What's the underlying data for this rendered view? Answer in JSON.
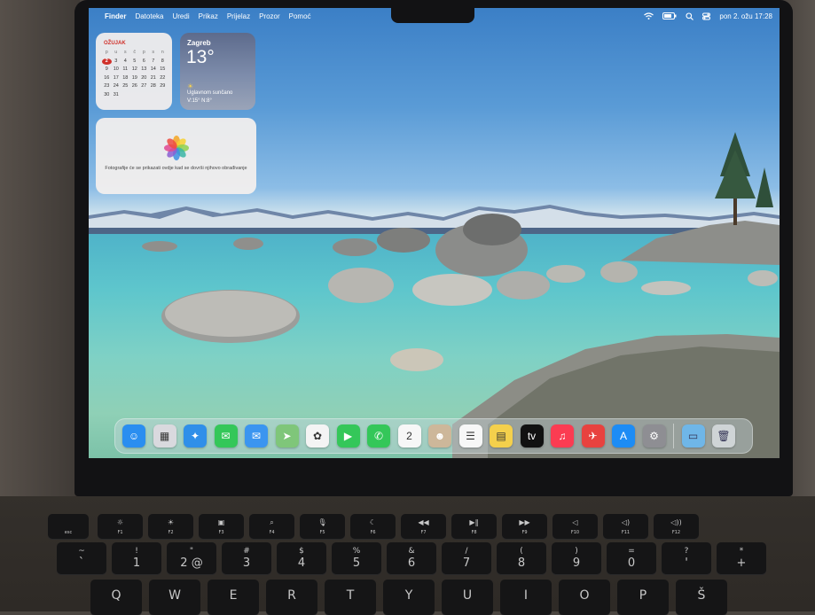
{
  "menubar": {
    "apple_glyph": "",
    "items": [
      "Finder",
      "Datoteka",
      "Uredi",
      "Prikaz",
      "Prijelaz",
      "Prozor",
      "Pomoć"
    ],
    "status_icons": [
      "wifi-icon",
      "battery-icon",
      "search-icon",
      "control-center-icon"
    ],
    "clock": "pon 2. ožu  17:28"
  },
  "calendar_widget": {
    "month": "OŽUJAK",
    "weekdays": [
      "p",
      "u",
      "s",
      "č",
      "p",
      "s",
      "n"
    ],
    "days": [
      [
        "",
        "",
        "",
        "",
        "",
        "",
        ""
      ],
      [
        "2",
        "3",
        "4",
        "5",
        "6",
        "7",
        "8"
      ],
      [
        "9",
        "10",
        "11",
        "12",
        "13",
        "14",
        "15"
      ],
      [
        "16",
        "17",
        "18",
        "19",
        "20",
        "21",
        "22"
      ],
      [
        "23",
        "24",
        "25",
        "26",
        "27",
        "28",
        "29"
      ],
      [
        "30",
        "31",
        "",
        "",
        "",
        "",
        ""
      ]
    ],
    "today": "2",
    "today_color": "#d0302a"
  },
  "weather_widget": {
    "city": "Zagreb",
    "temperature": "13°",
    "sun_glyph": "☀",
    "condition": "Uglavnom sunčano",
    "hi_lo": "V:15° N:8°"
  },
  "photos_widget": {
    "message": "Fotografije će se prikazati ovdje kad se dovrši njihovo obrađivanje"
  },
  "dock": {
    "apps": [
      {
        "name": "finder",
        "glyph": "☺",
        "color": "#2a8ef0"
      },
      {
        "name": "launchpad",
        "glyph": "▦",
        "color": "#d9d9de"
      },
      {
        "name": "safari",
        "glyph": "✦",
        "color": "#2f8fe9"
      },
      {
        "name": "messages",
        "glyph": "✉",
        "color": "#34c759"
      },
      {
        "name": "mail",
        "glyph": "✉",
        "color": "#3b95f0"
      },
      {
        "name": "maps",
        "glyph": "➤",
        "color": "#7fc67a"
      },
      {
        "name": "photos",
        "glyph": "✿",
        "color": "#f4f4f4"
      },
      {
        "name": "facetime",
        "glyph": "▶",
        "color": "#34c759"
      },
      {
        "name": "phone",
        "glyph": "✆",
        "color": "#34c759"
      },
      {
        "name": "calendar",
        "glyph": "2",
        "color": "#f7f7f7"
      },
      {
        "name": "contacts",
        "glyph": "☻",
        "color": "#cdb79a"
      },
      {
        "name": "reminders",
        "glyph": "☰",
        "color": "#f7f7f7"
      },
      {
        "name": "notes",
        "glyph": "▤",
        "color": "#f4d04c"
      },
      {
        "name": "tv",
        "glyph": "tv",
        "color": "#111111"
      },
      {
        "name": "music",
        "glyph": "♫",
        "color": "#fb3c52"
      },
      {
        "name": "rocket",
        "glyph": "✈",
        "color": "#e8423f"
      },
      {
        "name": "app-store",
        "glyph": "A",
        "color": "#1d8cf5"
      },
      {
        "name": "system-settings",
        "glyph": "⚙",
        "color": "#8e8e93"
      }
    ],
    "folder": {
      "name": "downloads-folder",
      "glyph": "▭",
      "color": "#6fb6e8"
    },
    "trash": {
      "name": "trash",
      "glyph": "🗑",
      "color": "#cfd4d6"
    }
  },
  "keyboard": {
    "fn_row": [
      {
        "label": "esc",
        "icon": ""
      },
      {
        "label": "F1",
        "icon": "☼"
      },
      {
        "label": "F2",
        "icon": "☀"
      },
      {
        "label": "F3",
        "icon": "▣"
      },
      {
        "label": "F4",
        "icon": "⌕"
      },
      {
        "label": "F5",
        "icon": "🎙"
      },
      {
        "label": "F6",
        "icon": "☾"
      },
      {
        "label": "F7",
        "icon": "◀◀"
      },
      {
        "label": "F8",
        "icon": "▶‖"
      },
      {
        "label": "F9",
        "icon": "▶▶"
      },
      {
        "label": "F10",
        "icon": "◁"
      },
      {
        "label": "F11",
        "icon": "◁)"
      },
      {
        "label": "F12",
        "icon": "◁))"
      }
    ],
    "num_row": [
      {
        "top": "~",
        "bot": "`"
      },
      {
        "top": "!",
        "bot": "1"
      },
      {
        "top": "\"",
        "bot": "2 @"
      },
      {
        "top": "#",
        "bot": "3"
      },
      {
        "top": "$",
        "bot": "4"
      },
      {
        "top": "%",
        "bot": "5"
      },
      {
        "top": "&",
        "bot": "6"
      },
      {
        "top": "/",
        "bot": "7"
      },
      {
        "top": "(",
        "bot": "8"
      },
      {
        "top": ")",
        "bot": "9"
      },
      {
        "top": "=",
        "bot": "0"
      },
      {
        "top": "?",
        "bot": "'"
      },
      {
        "top": "*",
        "bot": "+"
      }
    ],
    "letter_row": [
      "Q",
      "W",
      "E",
      "R",
      "T",
      "Y",
      "U",
      "I",
      "O",
      "P",
      "Š"
    ]
  }
}
